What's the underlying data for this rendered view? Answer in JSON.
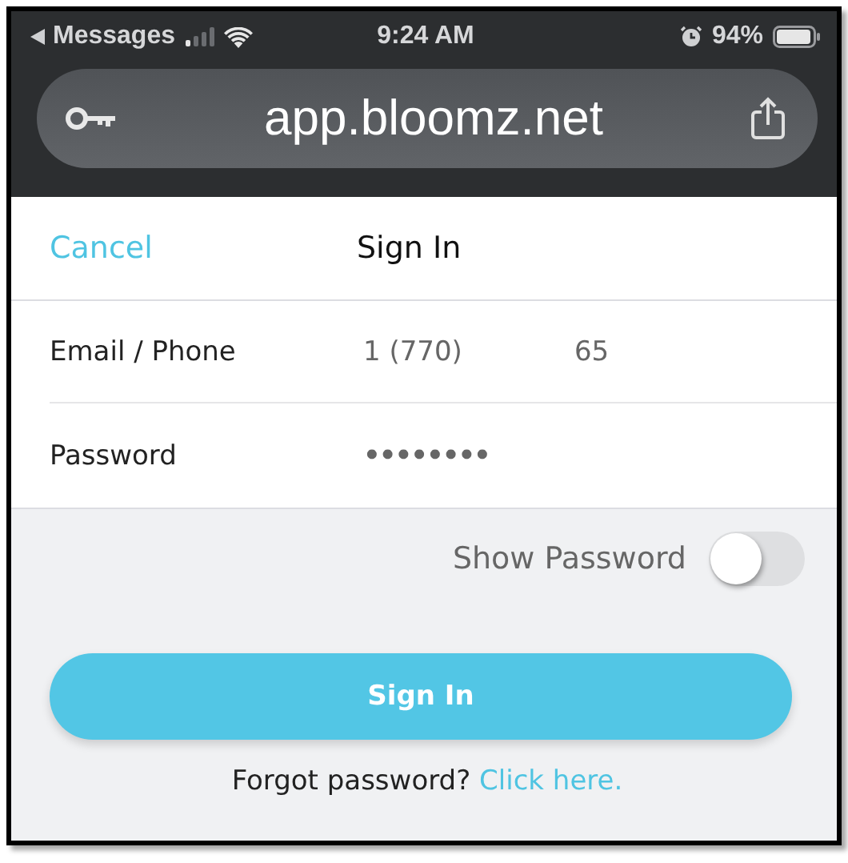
{
  "status_bar": {
    "back_label": "Messages",
    "time": "9:24 AM",
    "battery": "94%"
  },
  "address_bar": {
    "url": "app.bloomz.net"
  },
  "header": {
    "cancel": "Cancel",
    "title": "Sign In"
  },
  "fields": [
    {
      "label": "Email / Phone",
      "value_parts": [
        "1 (770)",
        "65"
      ],
      "kind": "text"
    },
    {
      "label": "Password",
      "value_parts": [
        "••••••••"
      ],
      "kind": "password"
    }
  ],
  "show_password": {
    "label": "Show Password",
    "on": false
  },
  "sign_in_button": "Sign In",
  "forgot": {
    "text": "Forgot password?",
    "link": "Click here."
  }
}
